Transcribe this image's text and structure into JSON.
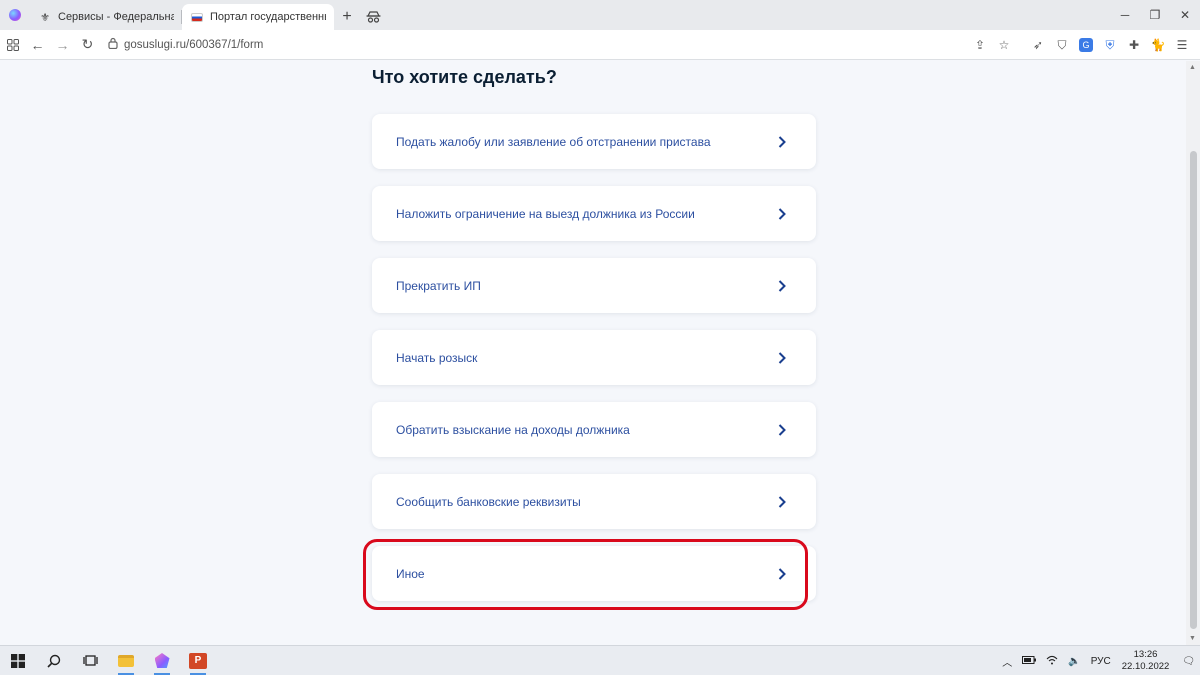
{
  "browser": {
    "tabs": [
      {
        "title": "Сервисы - Федеральная служ",
        "active": false
      },
      {
        "title": "Портал государственных усл",
        "active": true
      }
    ],
    "new_tab": "+",
    "address": {
      "url": "gosuslugi.ru/600367/1/form"
    }
  },
  "page": {
    "heading": "Что хотите сделать?",
    "options": [
      {
        "label": "Подать жалобу или заявление об отстранении пристава"
      },
      {
        "label": "Наложить ограничение на выезд должника из России"
      },
      {
        "label": "Прекратить ИП"
      },
      {
        "label": "Начать розыск"
      },
      {
        "label": "Обратить взыскание на доходы должника"
      },
      {
        "label": "Сообщить банковские реквизиты"
      },
      {
        "label": "Иное",
        "highlighted": true
      }
    ],
    "link_color": "#2c4fa0",
    "highlight_color": "#d9091c"
  },
  "taskbar": {
    "language": "РУС",
    "time": "13:26",
    "date": "22.10.2022"
  }
}
